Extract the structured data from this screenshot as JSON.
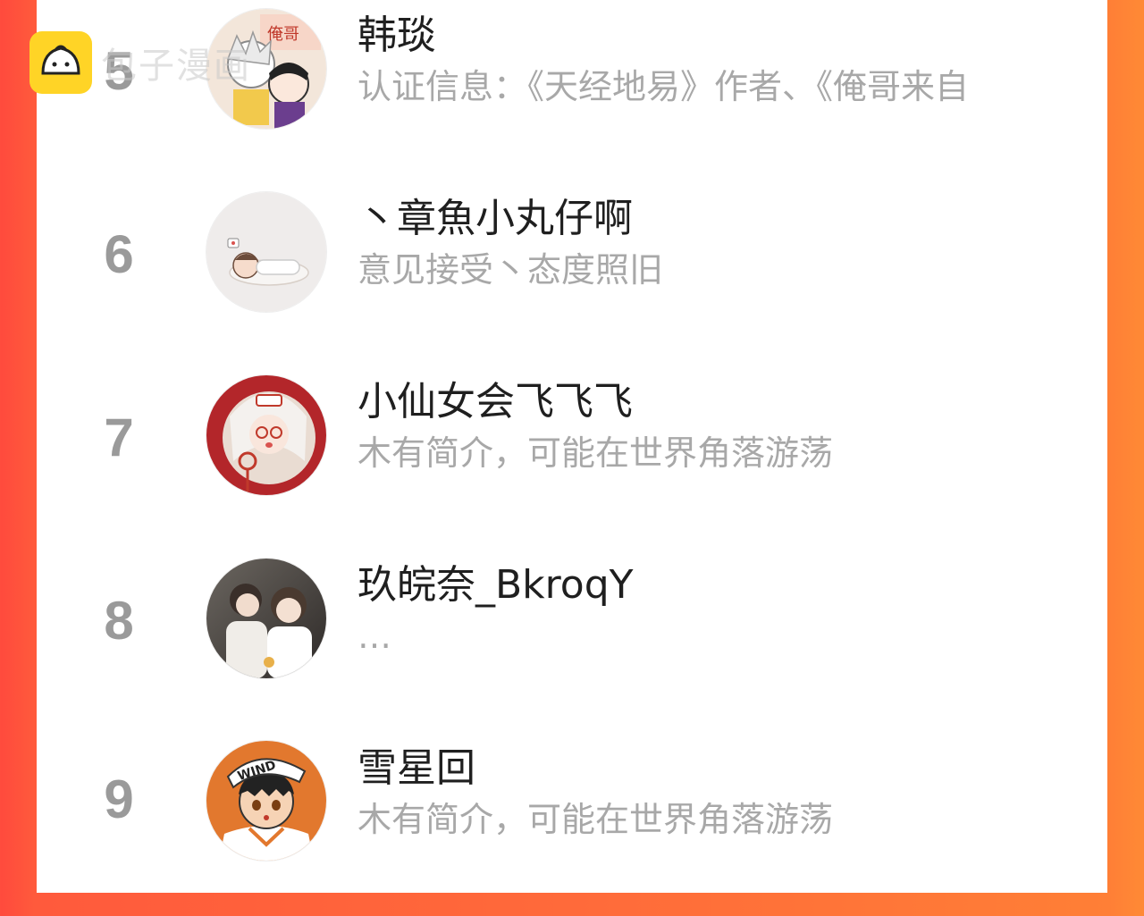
{
  "watermark": {
    "text": "包子漫画",
    "icon": "bun-logo-icon"
  },
  "ranking": [
    {
      "rank": "5",
      "name": "韩琰",
      "bio": "认证信息：《天经地易》作者、《俺哥来自",
      "avatar": "avatar-anime-duo-icon"
    },
    {
      "rank": "6",
      "name": "丶章魚小丸仔啊",
      "bio": "意见接受丶态度照旧",
      "avatar": "avatar-sleeping-baby-icon"
    },
    {
      "rank": "7",
      "name": "小仙女会飞飞飞",
      "bio": "木有简介，可能在世界角落游荡",
      "avatar": "avatar-red-girl-icon"
    },
    {
      "rank": "8",
      "name": "玖皖奈_BkroqY",
      "bio": "…",
      "avatar": "avatar-two-girls-icon"
    },
    {
      "rank": "9",
      "name": "雪星回",
      "bio": "木有简介，可能在世界角落游荡",
      "avatar": "avatar-wind-boy-icon"
    }
  ],
  "colors": {
    "accent_left": "#ff4a3d",
    "accent_right": "#ff8a35",
    "rank": "#9a9a9a",
    "name": "#1f1f1f",
    "bio": "#a8a8a8"
  }
}
